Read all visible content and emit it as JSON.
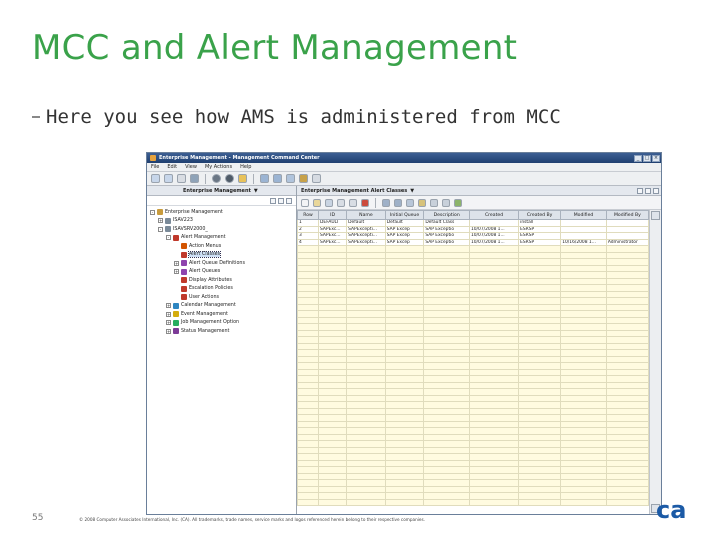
{
  "slide": {
    "title": "MCC and Alert Management",
    "bullet": "Here you see how AMS is administered from MCC",
    "page_number": "55",
    "copyright": "© 2008 Computer Associates International, Inc. (CA). All trademarks, trade names, service marks and logos referenced herein belong to their respective companies.",
    "logo_text": "ca"
  },
  "window": {
    "title": "Enterprise Management - Management Command Center",
    "menu": [
      "File",
      "Edit",
      "View",
      "My Actions",
      "Help"
    ]
  },
  "left_pane": {
    "header": "Enterprise Management",
    "tree": [
      {
        "label": "Enterprise Management",
        "level": 0,
        "expander": "-",
        "icon": "gear-icon",
        "color": "#c89b3c"
      },
      {
        "label": "ISAV223",
        "level": 1,
        "expander": "+",
        "icon": "server-icon",
        "color": "#7a8a99"
      },
      {
        "label": "ISAVSRV2000_",
        "level": 1,
        "expander": "-",
        "icon": "server-icon",
        "color": "#7a8a99"
      },
      {
        "label": "Alert Management",
        "level": 2,
        "expander": "-",
        "icon": "alert-icon",
        "color": "#c0392b"
      },
      {
        "label": "Action Menus",
        "level": 3,
        "expander": "",
        "icon": "action-icon",
        "color": "#d35400"
      },
      {
        "label": "Alert Classes",
        "level": 3,
        "expander": "",
        "icon": "alert-class-icon",
        "color": "#c0392b",
        "selected": true
      },
      {
        "label": "Alert Queue Definitions",
        "level": 3,
        "expander": "+",
        "icon": "queue-icon",
        "color": "#8e44ad"
      },
      {
        "label": "Alert Queues",
        "level": 3,
        "expander": "+",
        "icon": "queue-icon",
        "color": "#8e44ad"
      },
      {
        "label": "Display Attributes",
        "level": 3,
        "expander": "",
        "icon": "display-icon",
        "color": "#c0392b"
      },
      {
        "label": "Escalation Policies",
        "level": 3,
        "expander": "",
        "icon": "escalation-icon",
        "color": "#c0392b"
      },
      {
        "label": "User Actions",
        "level": 3,
        "expander": "",
        "icon": "user-action-icon",
        "color": "#c0392b"
      },
      {
        "label": "Calendar Management",
        "level": 2,
        "expander": "+",
        "icon": "calendar-icon",
        "color": "#2e86c1"
      },
      {
        "label": "Event Management",
        "level": 2,
        "expander": "+",
        "icon": "event-icon",
        "color": "#d4ac0d"
      },
      {
        "label": "Job Management Option",
        "level": 2,
        "expander": "+",
        "icon": "job-icon",
        "color": "#27ae60"
      },
      {
        "label": "Status Management",
        "level": 2,
        "expander": "+",
        "icon": "status-icon",
        "color": "#7d3c98"
      }
    ]
  },
  "right_pane": {
    "header": "Enterprise Management Alert Classes",
    "columns": [
      "Row",
      "ID",
      "Name",
      "Initial Queue",
      "Description",
      "Created",
      "Created By",
      "Modified",
      "Modified By"
    ],
    "rows": [
      [
        "1",
        "DEFAULT",
        "Default",
        "Default",
        "Default Class",
        "",
        "install",
        "",
        ""
      ],
      [
        "2",
        "SAPExc...",
        "SAPExcepti...",
        "SAP Excep",
        "SAP Exceptio",
        "10/07/2008 1...",
        "ESRSP",
        "",
        ""
      ],
      [
        "3",
        "SAPExc...",
        "SAPExcepti...",
        "SAP Excep",
        "SAP Exceptio",
        "10/07/2008 1...",
        "ESRSP",
        "",
        ""
      ],
      [
        "4",
        "SAPExc...",
        "SAPExcepti...",
        "SAP Excep",
        "SAP Exceptio",
        "10/07/2008 1...",
        "ESRSP",
        "10/16/2008 1...",
        "Administrator"
      ]
    ]
  },
  "colors": {
    "title_green": "#3aa24a",
    "titlebar_blue": "#2a4b80",
    "grid_empty": "#fffbe0",
    "logo_blue": "#1b5aa6"
  }
}
